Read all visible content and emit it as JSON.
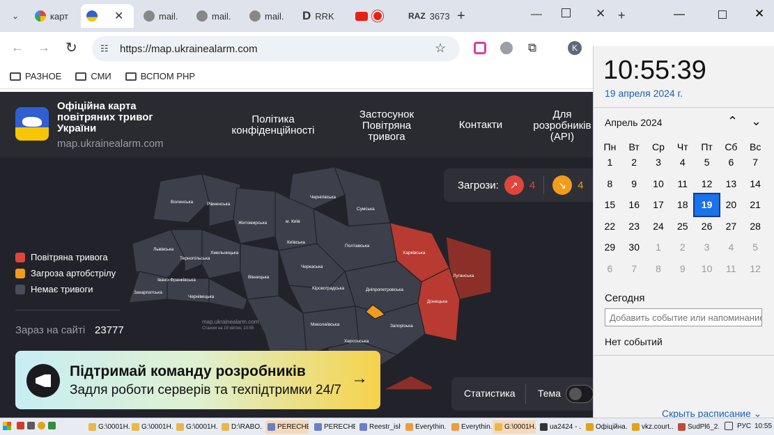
{
  "browser": {
    "tabs": [
      {
        "label": "карт",
        "icon": "google-icon"
      },
      {
        "label": "",
        "icon": "ukraine-alarm-icon",
        "active": true
      },
      {
        "label": "mail.",
        "icon": "globe-icon"
      },
      {
        "label": "mail.",
        "icon": "globe-icon"
      },
      {
        "label": "mail.",
        "icon": "globe-icon"
      },
      {
        "label": "RRK",
        "icon": "d-logo-icon"
      },
      {
        "label": "",
        "icon": "youtube-icon"
      },
      {
        "label": "3673",
        "icon": "raz-icon"
      }
    ],
    "url": "https://map.ukrainealarm.com",
    "profile_initial": "K",
    "bookmarks": [
      "РАЗНОЕ",
      "СМИ",
      "ВСПОМ PHP"
    ]
  },
  "site": {
    "title": "Офіційна карта повітряних тривог України",
    "domain": "map.ukrainealarm.com",
    "nav": [
      "Політика конфіденційності",
      "Застосунок Повітряна тривога",
      "Контакти",
      "Для розробників (API)"
    ],
    "threats_label": "Загрози:",
    "threat_counts": [
      "4",
      "4"
    ],
    "legend": [
      {
        "label": "Повітряна тривога",
        "color": "#e0453b"
      },
      {
        "label": "Загроза артобстрілу",
        "color": "#f29c1b"
      },
      {
        "label": "Немає тривоги",
        "color": "#4a4c58"
      }
    ],
    "online_label": "Зараз на сайті",
    "online_count": "23777",
    "map_watermark": "map.ukrainealarm.com",
    "map_status": "Станом на 19 квітня, 10:55",
    "banner_title": "Підтримай команду розробників",
    "banner_subtitle": "Задля роботи серверів та техпідтримки 24/7",
    "stats_label": "Статистика",
    "theme_label": "Тема",
    "regions": {
      "volyn": "Волинська",
      "rivne": "Рівненська",
      "chernihiv": "Чернігівська",
      "sumy": "Сумська",
      "zhytomyr": "Житомирська",
      "kyiv_city": "м. Київ",
      "kyiv": "Київська",
      "poltava": "Полтавська",
      "kharkiv": "Харківська",
      "lviv": "Львівська",
      "ternopil": "Тернопільська",
      "khmelnytskyi": "Хмельницька",
      "vinnytsia": "Вінницька",
      "cherkasy": "Черкаська",
      "luhansk": "Луганська",
      "ivano": "Івано-Франківська",
      "zakarpattia": "Закарпатська",
      "chernivtsi": "Чернівецька",
      "kirovohrad": "Кіровоградська",
      "dnipro": "Дніпропетровська",
      "donetsk": "Донецька",
      "mykolaiv": "Миколаївська",
      "zaporizhzhia": "Запорізька",
      "kherson": "Херсонська"
    }
  },
  "calendar": {
    "time": "10:55:39",
    "date": "19 апреля 2024 г.",
    "month": "Апрель 2024",
    "weekdays": [
      "Пн",
      "Вт",
      "Ср",
      "Чт",
      "Пт",
      "Сб",
      "Вс"
    ],
    "days": [
      [
        "1",
        "2",
        "3",
        "4",
        "5",
        "6",
        "7"
      ],
      [
        "8",
        "9",
        "10",
        "11",
        "12",
        "13",
        "14"
      ],
      [
        "15",
        "16",
        "17",
        "18",
        "19",
        "20",
        "21"
      ],
      [
        "22",
        "23",
        "24",
        "25",
        "26",
        "27",
        "28"
      ],
      [
        "29",
        "30",
        "1",
        "2",
        "3",
        "4",
        "5"
      ],
      [
        "6",
        "7",
        "8",
        "9",
        "10",
        "11",
        "12"
      ]
    ],
    "selected_day": "19",
    "today_label": "Сегодня",
    "add_event_placeholder": "Добавить событие или напоминание",
    "no_events": "Нет событий",
    "hide_schedule": "Скрыть расписание"
  },
  "taskbar": {
    "items": [
      "G:\\0001H...",
      "G:\\0001H...",
      "G:\\0001H...",
      "D:\\RABO...",
      "PERECHE...",
      "PERECHE...",
      "Reestr_ish...",
      "Everythin...",
      "Everythin...",
      "G:\\0001H...",
      "ua2424 - ...",
      "Офіційна...",
      "vkz.court...",
      "SudPl6_2..."
    ],
    "lang": "РУС",
    "clock": "10:55"
  },
  "colors": {
    "alarm": "#c0392b",
    "artillery": "#f29c1b",
    "calm": "#3d3f4b",
    "accent": "#1a73e8"
  }
}
